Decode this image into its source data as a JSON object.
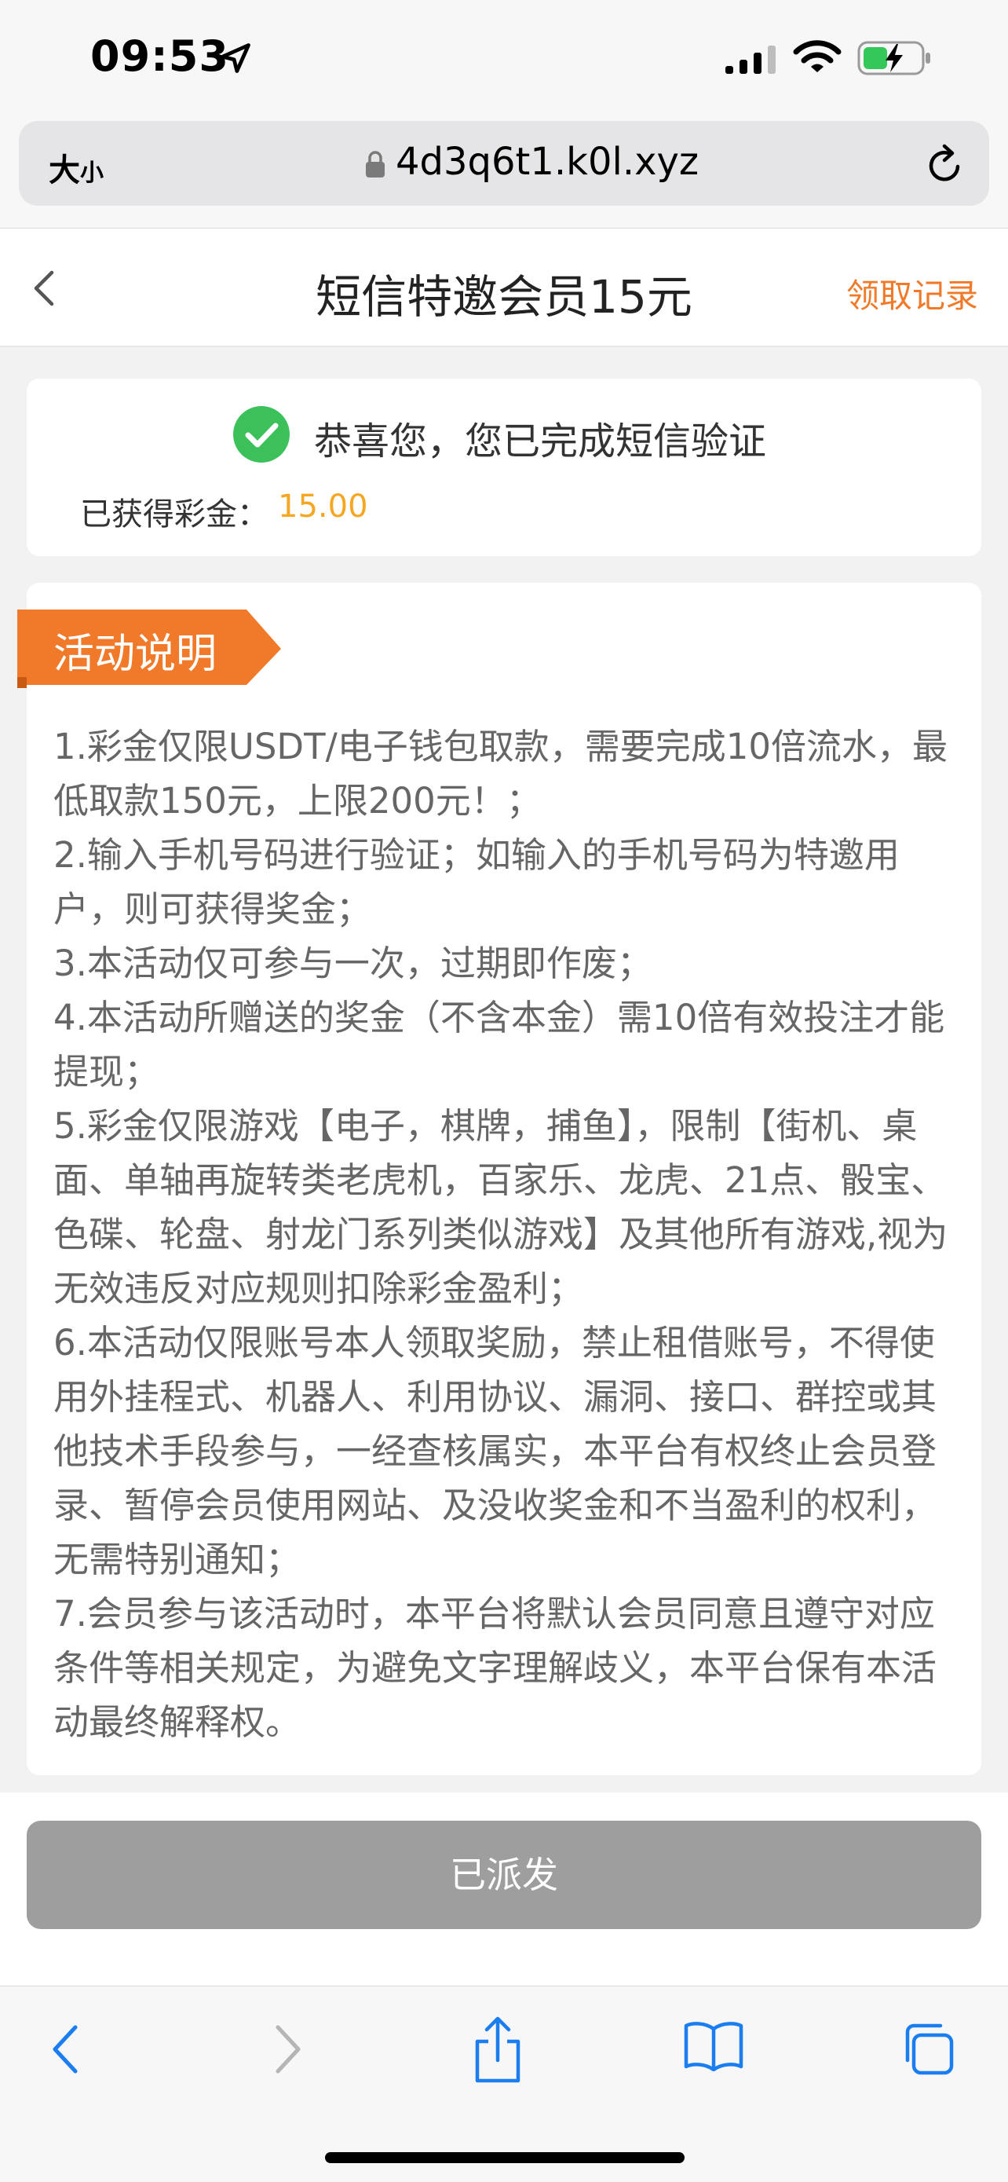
{
  "status_bar": {
    "time": "09:53"
  },
  "browser": {
    "text_size_label_big": "大",
    "text_size_label_small": "小",
    "url": "4d3q6t1.k0l.xyz"
  },
  "header": {
    "title": "短信特邀会员15元",
    "records_link": "领取记录"
  },
  "success": {
    "message": "恭喜您，您已完成短信验证",
    "bonus_label": "已获得彩金：",
    "bonus_value": "15.00"
  },
  "rules": {
    "tag_label": "活动说明",
    "items": [
      "1.彩金仅限USDT/电子钱包取款，需要完成10倍流水，最低取款150元，上限200元！；",
      "2.输入手机号码进行验证；如输入的手机号码为特邀用户，则可获得奖金；",
      "3.本活动仅可参与一次，过期即作废；",
      "4.本活动所赠送的奖金（不含本金）需10倍有效投注才能提现；",
      "5.彩金仅限游戏【电子，棋牌，捕鱼】，限制【街机、桌面、单轴再旋转类老虎机，百家乐、龙虎、21点、骰宝、色碟、轮盘、射龙门系列类似游戏】及其他所有游戏,视为无效违反对应规则扣除彩金盈利；",
      "6.本活动仅限账号本人领取奖励，禁止租借账号，不得使用外挂程式、机器人、利用协议、漏洞、接口、群控或其他技术手段参与，一经查核属实，本平台有权终止会员登录、暂停会员使用网站、及没收奖金和不当盈利的权利，无需特别通知；",
      "7.会员参与该活动时，本平台将默认会员同意且遵守对应条件等相关规定，为避免文字理解歧义，本平台保有本活动最终解释权。"
    ]
  },
  "action": {
    "button_label": "已派发"
  },
  "colors": {
    "accent_orange": "#f07a2a",
    "bonus_yellow": "#f5a623",
    "success_green": "#3cc15a",
    "disabled_gray": "#9e9e9e",
    "link_blue": "#1a7ef0"
  },
  "icons": [
    "location-arrow-icon",
    "signal-icon",
    "wifi-icon",
    "battery-charging-icon",
    "lock-icon",
    "reload-icon",
    "back-chevron-icon",
    "check-circle-icon",
    "safari-back-icon",
    "safari-forward-icon",
    "share-icon",
    "bookmarks-icon",
    "tabs-icon"
  ]
}
